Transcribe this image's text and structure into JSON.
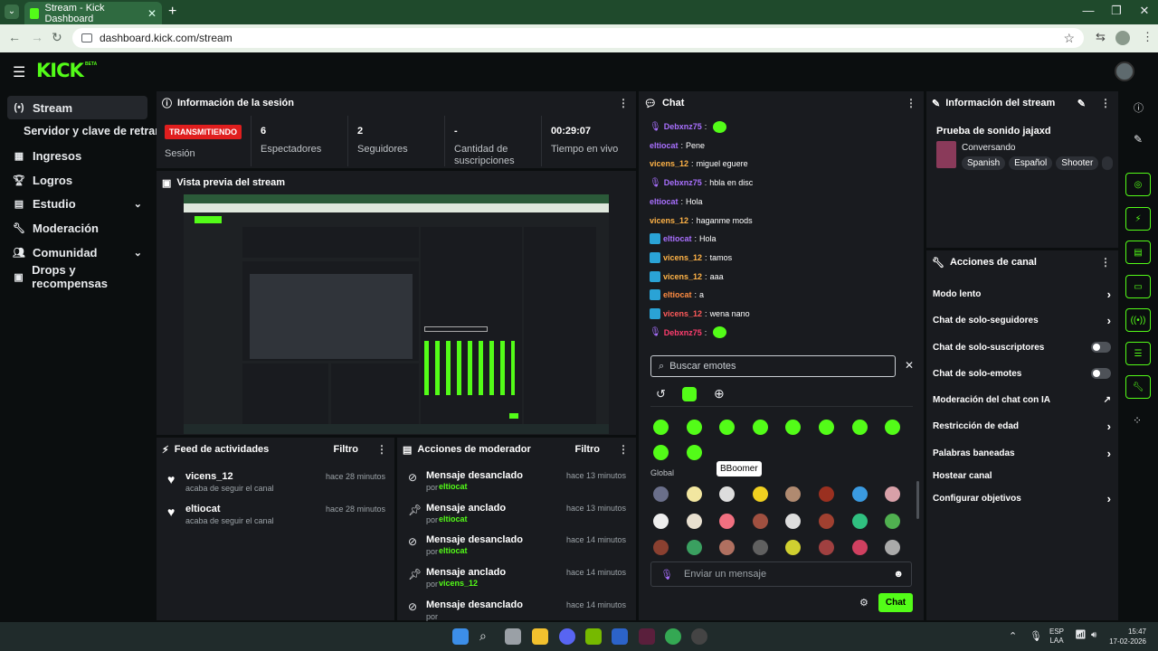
{
  "browser": {
    "tab_title": "Stream - Kick Dashboard",
    "url": "dashboard.kick.com/stream"
  },
  "app": {
    "logo": "KICK",
    "logo_badge": "BETA"
  },
  "sidebar": {
    "items": [
      {
        "label": "Stream",
        "icon": "stream-icon"
      },
      {
        "label": "Servidor y clave de retransm",
        "icon": ""
      },
      {
        "label": "Ingresos",
        "icon": "money-icon"
      },
      {
        "label": "Logros",
        "icon": "trophy-icon"
      },
      {
        "label": "Estudio",
        "icon": "studio-icon"
      },
      {
        "label": "Moderación",
        "icon": "wrench-icon"
      },
      {
        "label": "Comunidad",
        "icon": "community-icon"
      },
      {
        "label": "Drops y recompensas",
        "icon": "gift-icon"
      }
    ]
  },
  "session": {
    "title": "Información de la sesión",
    "live_badge": "TRANSMITIENDO",
    "session_label": "Sesión",
    "stats": [
      {
        "value": "6",
        "label": "Espectadores"
      },
      {
        "value": "2",
        "label": "Seguidores"
      },
      {
        "value": "-",
        "label": "Cantidad de suscripciones"
      },
      {
        "value": "00:29:07",
        "label": "Tiempo en vivo"
      }
    ]
  },
  "preview": {
    "title": "Vista previa del stream"
  },
  "activity": {
    "title": "Feed de actividades",
    "filter": "Filtro",
    "items": [
      {
        "name": "vicens_12",
        "sub": "acaba de seguir el canal",
        "time": "hace 28 minutos"
      },
      {
        "name": "eltiocat",
        "sub": "acaba de seguir el canal",
        "time": "hace 28 minutos"
      }
    ]
  },
  "modactions": {
    "title": "Acciones de moderador",
    "filter": "Filtro",
    "by_prefix": "por",
    "items": [
      {
        "action": "Mensaje desanclado",
        "by": "eltiocat",
        "time": "hace 13 minutos",
        "icon": "unpin-icon"
      },
      {
        "action": "Mensaje anclado",
        "by": "eltiocat",
        "time": "hace 13 minutos",
        "icon": "pin-icon"
      },
      {
        "action": "Mensaje desanclado",
        "by": "eltiocat",
        "time": "hace 14 minutos",
        "icon": "unpin-icon"
      },
      {
        "action": "Mensaje anclado",
        "by": "vicens_12",
        "time": "hace 14 minutos",
        "icon": "pin-icon"
      },
      {
        "action": "Mensaje desanclado",
        "by": "",
        "time": "hace 14 minutos",
        "icon": "unpin-icon"
      }
    ]
  },
  "chat": {
    "title": "Chat",
    "messages": [
      {
        "user": "Debxnz75",
        "text": "",
        "color": "#a970ff",
        "badge": "mic"
      },
      {
        "user": "eltiocat",
        "text": "Pene",
        "color": "#a970ff",
        "badge": ""
      },
      {
        "user": "vicens_12",
        "text": "miguel eguere",
        "color": "#ffb347",
        "badge": ""
      },
      {
        "user": "Debxnz75",
        "text": "hbla en disc",
        "color": "#a970ff",
        "badge": "mic"
      },
      {
        "user": "eltiocat",
        "text": "Hola",
        "color": "#a970ff",
        "badge": ""
      },
      {
        "user": "vicens_12",
        "text": "haganme mods",
        "color": "#ffb347",
        "badge": ""
      },
      {
        "user": "eltiocat",
        "text": "Hola",
        "color": "#a970ff",
        "badge": "mod"
      },
      {
        "user": "vicens_12",
        "text": "tamos",
        "color": "#ffb347",
        "badge": "mod"
      },
      {
        "user": "vicens_12",
        "text": "aaa",
        "color": "#ffb347",
        "badge": "mod"
      },
      {
        "user": "eltiocat",
        "text": "a",
        "color": "#ff8c42",
        "badge": "mod"
      },
      {
        "user": "vicens_12",
        "text": "wena nano",
        "color": "#ff5a5a",
        "badge": "mod"
      },
      {
        "user": "Debxnz75",
        "text": "",
        "color": "#ff3d6e",
        "badge": "mic"
      }
    ],
    "emote_search_placeholder": "Buscar emotes",
    "global_label": "Global",
    "tooltip": "BBoomer",
    "input_placeholder": "Enviar un mensaje",
    "send_label": "Chat"
  },
  "stream_info": {
    "title": "Información del stream",
    "stream_title": "Prueba de sonido jajaxd",
    "category": "Conversando",
    "tags": [
      "Spanish",
      "Español",
      "Shooter"
    ]
  },
  "channel_actions": {
    "title": "Acciones de canal",
    "items": [
      {
        "label": "Modo lento",
        "control": "arrow"
      },
      {
        "label": "Chat de solo-seguidores",
        "control": "arrow"
      },
      {
        "label": "Chat de solo-suscriptores",
        "control": "toggle"
      },
      {
        "label": "Chat de solo-emotes",
        "control": "toggle"
      },
      {
        "label": "Moderación del chat con IA",
        "control": "external"
      },
      {
        "label": "Restricción de edad",
        "control": "arrow"
      },
      {
        "label": "Palabras baneadas",
        "control": "arrow"
      },
      {
        "label": "Hostear canal",
        "control": "none"
      },
      {
        "label": "Configurar objetivos",
        "control": "arrow"
      }
    ]
  },
  "taskbar": {
    "lang": "ESP",
    "lang2": "LAA",
    "time": "15:47",
    "date": "17-02-2026"
  },
  "colors": {
    "accent": "#53fc18",
    "live": "#e01e1e"
  }
}
